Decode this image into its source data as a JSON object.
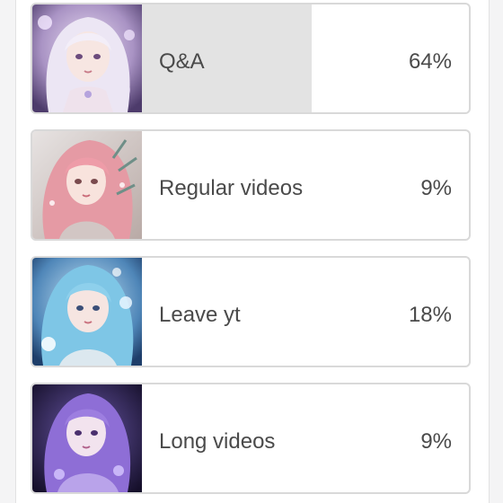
{
  "poll": {
    "options": [
      {
        "label": "Q&A",
        "percent_text": "64%",
        "percent": 64,
        "avatar_icon": "anime-girl-silver-hair-avatar"
      },
      {
        "label": "Regular videos",
        "percent_text": "9%",
        "percent": 9,
        "avatar_icon": "anime-girl-pink-hair-avatar"
      },
      {
        "label": "Leave yt",
        "percent_text": "18%",
        "percent": 18,
        "avatar_icon": "anime-girl-blue-hair-avatar"
      },
      {
        "label": "Long videos",
        "percent_text": "9%",
        "percent": 9,
        "avatar_icon": "anime-girl-purple-hair-avatar"
      }
    ]
  },
  "colors": {
    "bar_fill": "#e3e3e3",
    "option_border": "#d9d9d9",
    "text": "#4a4a4a"
  }
}
